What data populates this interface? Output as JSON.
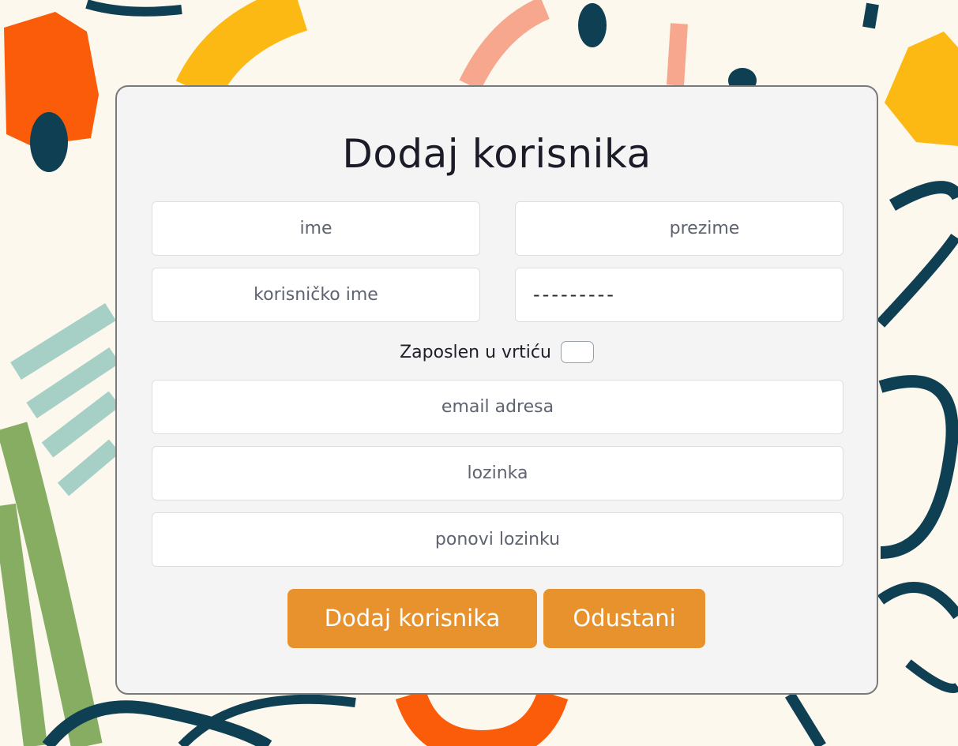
{
  "form": {
    "title": "Dodaj korisnika",
    "fields": {
      "ime_placeholder": "ime",
      "prezime_placeholder": "prezime",
      "korisnicko_ime_placeholder": "korisničko ime",
      "second_row_right_value": "---------",
      "email_placeholder": "email adresa",
      "lozinka_placeholder": "lozinka",
      "ponovi_lozinku_placeholder": "ponovi lozinku"
    },
    "checkbox": {
      "label": "Zaposlen u vrtiću",
      "checked": false
    },
    "buttons": {
      "submit_label": "Dodaj korisnika",
      "cancel_label": "Odustani"
    }
  },
  "colors": {
    "background": "#fcf8ee",
    "card_background": "#f4f4f4",
    "button": "#e8922e",
    "navy_stroke": "#0f3f52",
    "orange_stroke": "#fb5c09",
    "yellow_stroke": "#fdb913",
    "green_stroke": "#86ad61",
    "teal_stroke": "#a6d0c6",
    "peach_stroke": "#f7a78e"
  }
}
